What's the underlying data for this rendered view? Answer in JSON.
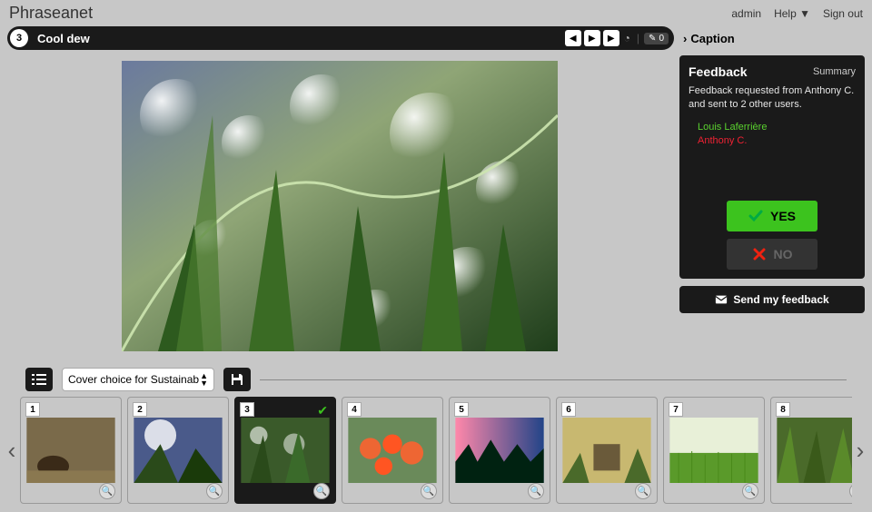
{
  "brand": "Phraseanet",
  "topnav": {
    "admin": "admin",
    "help": "Help ▼",
    "signout": "Sign out"
  },
  "titlebar": {
    "index": "3",
    "title": "Cool dew",
    "edit_count": "0"
  },
  "caption_label": "Caption",
  "feedback": {
    "title": "Feedback",
    "summary": "Summary",
    "message": "Feedback requested from Anthony C. and sent to 2 other users.",
    "user_yes": "Louis Laferrière",
    "user_no": "Anthony C.",
    "yes": "YES",
    "no": "NO"
  },
  "send_label": "Send my feedback",
  "toolbar": {
    "select_label": "Cover choice for Sustainab"
  },
  "thumbs": [
    {
      "idx": "1"
    },
    {
      "idx": "2"
    },
    {
      "idx": "3",
      "selected": true
    },
    {
      "idx": "4"
    },
    {
      "idx": "5"
    },
    {
      "idx": "6"
    },
    {
      "idx": "7"
    },
    {
      "idx": "8"
    }
  ]
}
